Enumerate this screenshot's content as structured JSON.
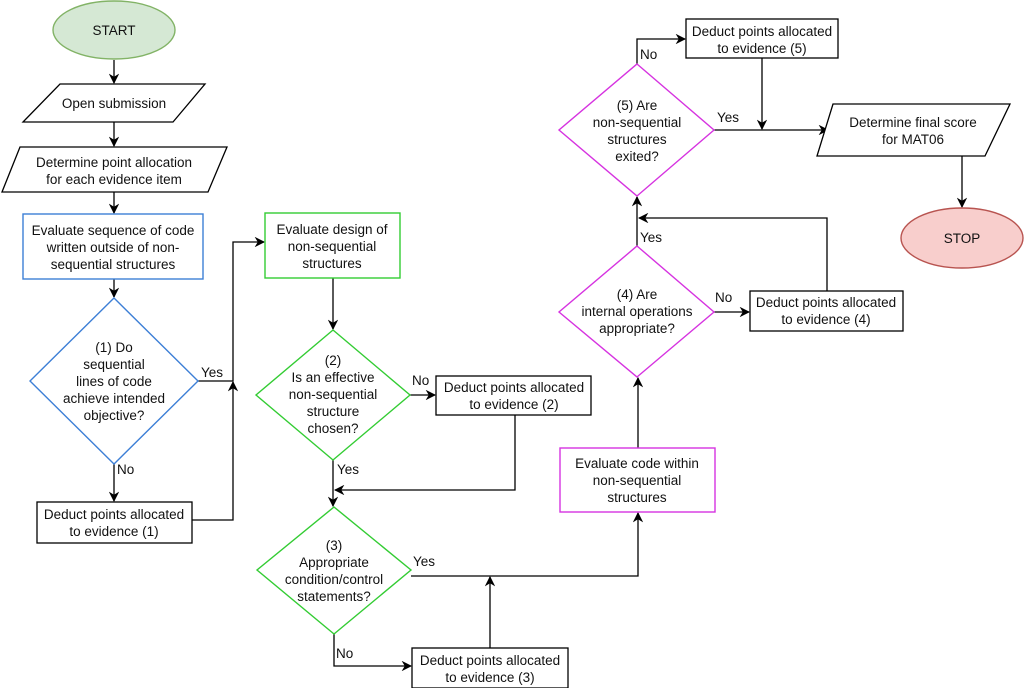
{
  "colors": {
    "start_fill": "#d5e8d4",
    "start_stroke": "#82b366",
    "stop_fill": "#f8cecc",
    "stop_stroke": "#b85450",
    "sequence_stroke": "#3d7fd6",
    "design_stroke": "#33cc33",
    "internal_stroke": "#d633e0"
  },
  "nodes": {
    "start": {
      "lines": [
        "START"
      ]
    },
    "open": {
      "lines": [
        "Open submission"
      ]
    },
    "determine_alloc": {
      "lines": [
        "Determine point allocation",
        "for each evidence item"
      ]
    },
    "eval_sequence": {
      "lines": [
        "Evaluate sequence of code",
        "written outside of non-",
        "sequential structures"
      ]
    },
    "q1": {
      "lines": [
        "(1) Do",
        "sequential",
        "lines of code",
        "achieve intended",
        "objective?"
      ]
    },
    "deduct1": {
      "lines": [
        "Deduct points allocated",
        "to evidence (1)"
      ]
    },
    "eval_design": {
      "lines": [
        "Evaluate design of",
        "non-sequential",
        "structures"
      ]
    },
    "q2": {
      "lines": [
        "(2)",
        "Is an effective",
        "non-sequential",
        "structure",
        "chosen?"
      ]
    },
    "deduct2": {
      "lines": [
        "Deduct points allocated",
        "to evidence (2)"
      ]
    },
    "q3": {
      "lines": [
        "(3)",
        "Appropriate",
        "condition/control",
        "statements?"
      ]
    },
    "deduct3": {
      "lines": [
        "Deduct points allocated",
        "to evidence (3)"
      ]
    },
    "eval_internal": {
      "lines": [
        "Evaluate code within",
        "non-sequential",
        "structures"
      ]
    },
    "q4": {
      "lines": [
        "(4) Are",
        "internal operations",
        "appropriate?"
      ]
    },
    "deduct4": {
      "lines": [
        "Deduct points allocated",
        "to evidence (4)"
      ]
    },
    "q5": {
      "lines": [
        "(5) Are",
        "non-sequential",
        "structures",
        "exited?"
      ]
    },
    "deduct5": {
      "lines": [
        "Deduct points allocated",
        "to evidence (5)"
      ]
    },
    "final": {
      "lines": [
        "Determine final score",
        "for MAT06"
      ]
    },
    "stop": {
      "lines": [
        "STOP"
      ]
    }
  },
  "edge_labels": {
    "q1_yes": "Yes",
    "q1_no": "No",
    "q2_yes": "Yes",
    "q2_no": "No",
    "q3_yes": "Yes",
    "q3_no": "No",
    "q4_yes": "Yes",
    "q4_no": "No",
    "q5_yes": "Yes",
    "q5_no": "No"
  }
}
